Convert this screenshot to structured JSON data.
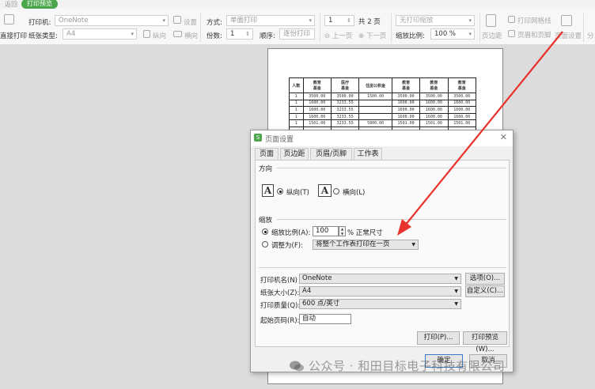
{
  "tabs": {
    "back": "返回",
    "active": "打印预览"
  },
  "ribbon": {
    "printer_label": "打印机:",
    "printer_value": "OneNote",
    "settings_label": "设置",
    "paper_type_label": "纸张类型:",
    "paper_type_value": "A4",
    "portrait_label": "纵向",
    "landscape_label": "横向",
    "direct_print_label": "直接打印",
    "mode_label": "方式:",
    "mode_value": "单面打印",
    "copies_label": "份数:",
    "copies_value": "1",
    "order_label": "顺序:",
    "order_value": "逐份打印",
    "page_value": "1",
    "page_total": "共 2 页",
    "prev_page": "上一页",
    "next_page": "下一页",
    "no_scale": "无打印缩放",
    "scale_label": "缩放比例:",
    "scale_value": "100 %",
    "margins_label": "页边距",
    "gridlines_label": "打印网格线",
    "header_footer_label": "页眉和页脚",
    "page_setup_label": "页面设置",
    "split_label": "分"
  },
  "preview_table": {
    "headers": [
      "人数",
      "教育\n基金",
      "医疗\n基金",
      "住房公积金",
      "教育\n基金",
      "教育\n基金",
      "教育\n基金"
    ],
    "subheader": "",
    "rows": [
      [
        "1",
        "3500.00",
        "3500.00",
        "1500.00",
        "3500.00",
        "3500.00",
        "3500.00"
      ],
      [
        "1",
        "1600.00",
        "3233.55",
        "",
        "1600.00",
        "1600.00",
        "1600.00"
      ],
      [
        "1",
        "1600.00",
        "3233.55",
        "",
        "1600.00",
        "1600.00",
        "1600.00"
      ],
      [
        "1",
        "1600.00",
        "3233.55",
        "",
        "1600.00",
        "1600.00",
        "1600.00"
      ],
      [
        "1",
        "1501.00",
        "3233.55",
        "5800.00",
        "1501.00",
        "1501.00",
        "1501.00"
      ]
    ]
  },
  "dialog": {
    "title": "页面设置",
    "tabs": [
      "页面",
      "页边距",
      "页眉/页脚",
      "工作表"
    ],
    "orientation_heading": "方向",
    "portrait": "纵向(T)",
    "landscape": "横向(L)",
    "scaling_heading": "缩放",
    "scale_ratio_label": "缩放比例(A):",
    "scale_ratio_value": "100",
    "scale_suffix": "% 正常尺寸",
    "fit_label": "调整为(F):",
    "fit_value": "将整个工作表打印在一页",
    "printer_name_label": "打印机名(N)",
    "printer_name_value": "OneNote",
    "options_button": "选项(O)...",
    "paper_size_label": "纸张大小(Z):",
    "paper_size_value": "A4",
    "custom_button": "自定义(C)...",
    "quality_label": "打印质量(Q):",
    "quality_value": "600 点/英寸",
    "first_page_label": "起始页码(R):",
    "first_page_value": "自动",
    "print_button": "打印(P)...",
    "preview_button": "打印预览(W)...",
    "ok_button": "确定",
    "cancel_button": "取消"
  },
  "watermark": "公众号 · 和田目标电子科技有限公司",
  "colors": {
    "accent": "#4ca64c",
    "arrow": "#e8322b"
  }
}
